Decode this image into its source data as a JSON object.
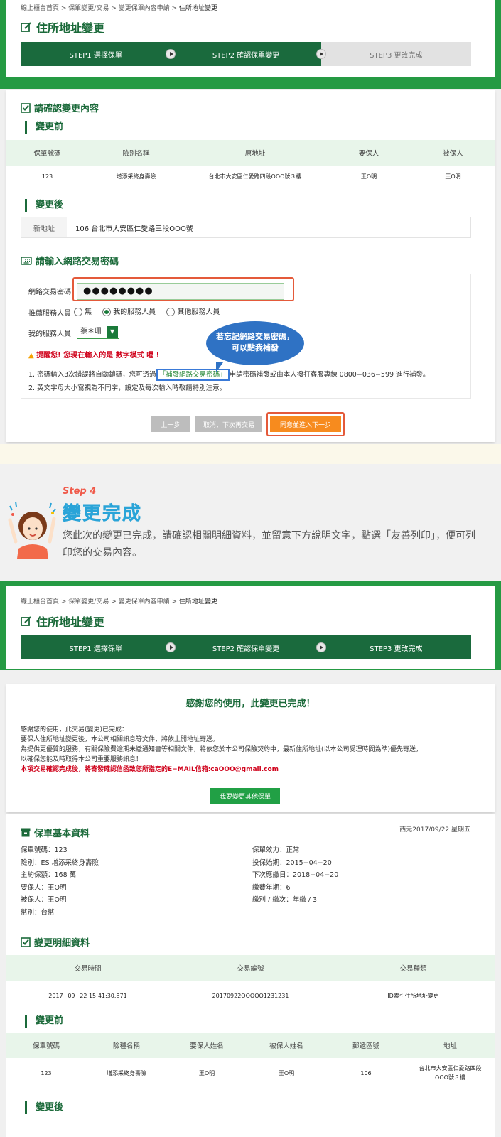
{
  "breadcrumb": {
    "home": "線上櫃台首頁",
    "sep": " > ",
    "level2": "保單變更/交易",
    "level3": "變更保單內容申請",
    "current": "住所地址變更"
  },
  "page_title": "住所地址變更",
  "steps": [
    "STEP1 選擇保單",
    "STEP2 確認保單變更",
    "STEP3 更改完成"
  ],
  "confirm": {
    "title": "請確認變更內容",
    "before_label": "變更前",
    "columns": [
      "保單號碼",
      "險別名稱",
      "原地址",
      "要保人",
      "被保人"
    ],
    "row": [
      "123",
      "增添采終身壽險",
      "台北市大安區仁愛路四段OOO號３樓",
      "王O明",
      "王O明"
    ],
    "after_label": "變更後",
    "new_addr_label": "新地址",
    "new_addr_value": "106 台北市大安區仁愛路三段OOO號"
  },
  "password": {
    "title": "請輸入網路交易密碼",
    "pw_label": "網路交易密碼",
    "pw_value": "●●●●●●●●",
    "rec_label": "推薦服務人員",
    "opt_none": "無",
    "opt_mine": "我的服務人員",
    "opt_other": "其他服務人員",
    "my_agent_label": "我的服務人員",
    "my_agent_value": "蔡＊珊",
    "warning": "提醒您! 您現在輸入的是 數字模式 喔 !",
    "note1_a": "1. 密碼輸入3次錯誤將自動鎖碼，您可透過",
    "note1_link": "「補發網路交易密碼」",
    "note1_b": "申請密碼補發或由本人撥打客服專線 0800−036−599 進行補發。",
    "note2": "2. 英文字母大小寫視為不同字，設定及每次輸入時敬請特別注意。",
    "bubble_line1": "若忘記網路交易密碼，",
    "bubble_line2": "可以點我補發"
  },
  "buttons": {
    "prev": "上一步",
    "cancel": "取消，下次再交易",
    "agree": "同意並進入下一步",
    "change_other": "我要變更其他保單"
  },
  "step4": {
    "label": "Step 4",
    "title": "變更完成",
    "desc": "您此次的變更已完成，請確認相關明細資料，並留意下方說明文字，點選「友善列印」，便可列印您的交易內容。"
  },
  "complete": {
    "thanks": "感謝您的使用，此變更已完成！",
    "msg1": "感謝您的使用，此交易(變更)已完成：",
    "msg2": "要保人住所地址變更後，本公司相關訊息等文件，將依上開地址寄送。",
    "msg3": "為提供更優質的服務，有關保險費逾期未繳通知書等相關文件，將依您於本公司保險契約中，最新住所地址(以本公司受理時間為準)優先寄送，",
    "msg4": "以確保您能及時取得本公司重要服務訊息！",
    "msg5": "本項交易確認完成後，將寄發確認信函致您所指定的E−MAIL信箱:caOOO@gmail.com"
  },
  "policy_info": {
    "title": "保單基本資料",
    "date": "西元2017/09/22 星期五",
    "left": [
      "保單號碼：123",
      "險別：ES 增添采終身壽險",
      "主約保額：168 萬",
      "要保人：王O明",
      "被保人：王O明",
      "幣別：台幣"
    ],
    "right": [
      "保單效力：正常",
      "投保始期：2015−04−20",
      "下次應繳日：2018−04−20",
      "繳費年期：6",
      "繳別 / 繳次：年繳  /  3"
    ]
  },
  "detail": {
    "title": "變更明細資料",
    "columns": [
      "交易時間",
      "交易編號",
      "交易種類"
    ],
    "row": [
      "2017−09−22 15:41:30.871",
      "20170922OOOOO1231231",
      "ID索引住所地址變更"
    ]
  },
  "before2": {
    "label": "變更前",
    "columns": [
      "保單號碼",
      "險種名稱",
      "要保人姓名",
      "被保人姓名",
      "郵遞區號",
      "地址"
    ],
    "row": [
      "123",
      "增添采終身壽險",
      "王O明",
      "王O明",
      "106"
    ],
    "addr_line1": "台北市大安區仁愛路四段",
    "addr_line2": "OOO號３樓"
  },
  "after2": {
    "label": "變更後"
  },
  "colors": {
    "brand_green": "#259a43",
    "dark_green": "#1a6a3d",
    "accent_orange": "#f78b1e",
    "alert_red": "#d0021b"
  }
}
